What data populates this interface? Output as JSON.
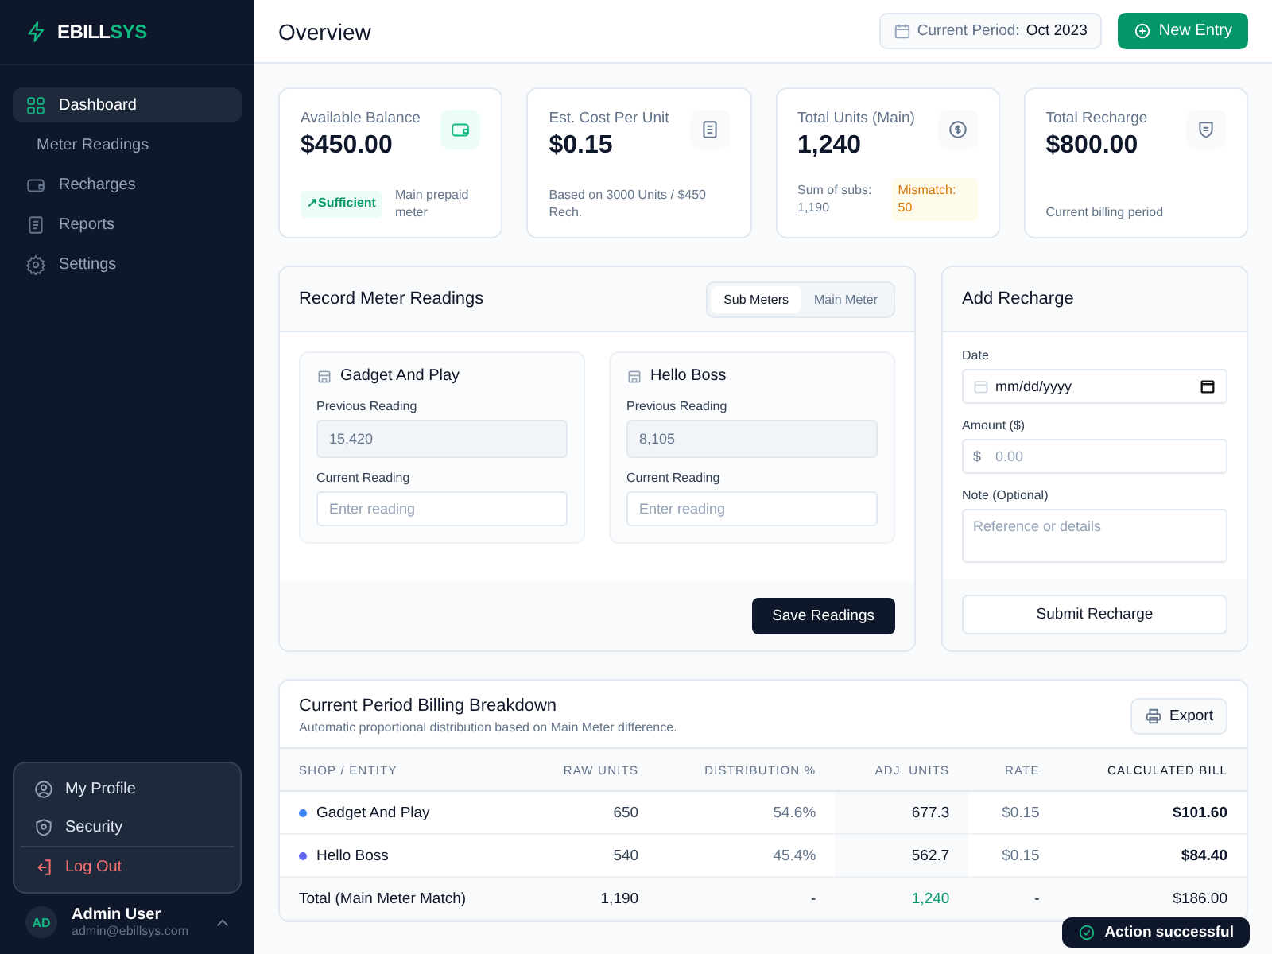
{
  "brand": {
    "name_a": "EBILL",
    "name_b": "SYS"
  },
  "sidebar": {
    "items": [
      {
        "label": "Dashboard",
        "kind": "grid",
        "selected": true
      },
      {
        "label": "Meter Readings",
        "kind": "sub",
        "selected": false
      },
      {
        "label": "Recharges",
        "kind": "wallet",
        "selected": false
      },
      {
        "label": "Reports",
        "kind": "document",
        "selected": false
      },
      {
        "label": "Settings",
        "kind": "gear",
        "selected": false
      }
    ]
  },
  "user_menu": {
    "items": [
      {
        "label": "My Profile",
        "kind": "profile"
      },
      {
        "label": "Security",
        "kind": "security"
      },
      {
        "label": "Log Out",
        "kind": "danger"
      }
    ]
  },
  "user": {
    "initials": "AD",
    "name": "Admin User",
    "email": "admin@ebillsys.com"
  },
  "header": {
    "title": "Overview",
    "period_label": "Current Period:",
    "period_value": "Oct 2023",
    "new_button": "New Entry"
  },
  "stats": [
    {
      "label": "Available Balance",
      "value": "$450.00",
      "kind": "wallet",
      "badge": {
        "text": "↗Sufficient",
        "kind": "success"
      },
      "note": "Main prepaid meter"
    },
    {
      "label": "Est. Cost Per Unit",
      "value": "$0.15",
      "kind": "receipt",
      "note": "Based on 3000 Units / $450 Rech."
    },
    {
      "label": "Total Units (Main)",
      "value": "1,240",
      "kind": "coin",
      "note": "Sum of subs: 1,190",
      "badge": {
        "text": "Mismatch: 50",
        "kind": "warning"
      }
    },
    {
      "label": "Total Recharge",
      "value": "$800.00",
      "kind": "shield",
      "note": "Current billing period"
    }
  ],
  "readings": {
    "title": "Record Meter Readings",
    "tabs": [
      {
        "label": "Sub Meters",
        "selected": true
      },
      {
        "label": "Main Meter",
        "selected": false
      }
    ],
    "meters": [
      {
        "name": "Gadget And Play",
        "previous_label": "Previous Reading",
        "previous_value": "15,420",
        "current_label": "Current Reading",
        "current_placeholder": "Enter reading"
      },
      {
        "name": "Hello Boss",
        "previous_label": "Previous Reading",
        "previous_value": "8,105",
        "current_label": "Current Reading",
        "current_placeholder": "Enter reading"
      }
    ],
    "save_button": "Save Readings"
  },
  "recharge": {
    "title": "Add Recharge",
    "date_label": "Date",
    "date_placeholder": "mm/dd/yyyy",
    "amount_label": "Amount ($)",
    "currency": "$",
    "amount_placeholder": "0.00",
    "note_label": "Note (Optional)",
    "note_placeholder": "Reference or details",
    "submit": "Submit Recharge"
  },
  "billing": {
    "title": "Current Period Billing Breakdown",
    "subtitle": "Automatic proportional distribution based on Main Meter difference.",
    "export": "Export",
    "table": {
      "columns": [
        "SHOP / ENTITY",
        "RAW UNITS",
        "DISTRIBUTION %",
        "ADJ. UNITS",
        "RATE",
        "CALCULATED BILL"
      ],
      "rows": [
        {
          "name": "Gadget And Play",
          "color": "#3b82f6",
          "raw": "650",
          "distribution": "54.6%",
          "adjusted": "677.3",
          "rate": "$0.15",
          "bill": "$101.60"
        },
        {
          "name": "Hello Boss",
          "color": "#6366f1",
          "raw": "540",
          "distribution": "45.4%",
          "adjusted": "562.7",
          "rate": "$0.15",
          "bill": "$84.40"
        }
      ],
      "total": {
        "name": "Total (Main Meter Match)",
        "raw": "1,190",
        "distribution": "-",
        "adjusted": "1,240",
        "rate": "-",
        "bill": "$186.00"
      }
    }
  },
  "toast": {
    "message": "Action successful"
  }
}
